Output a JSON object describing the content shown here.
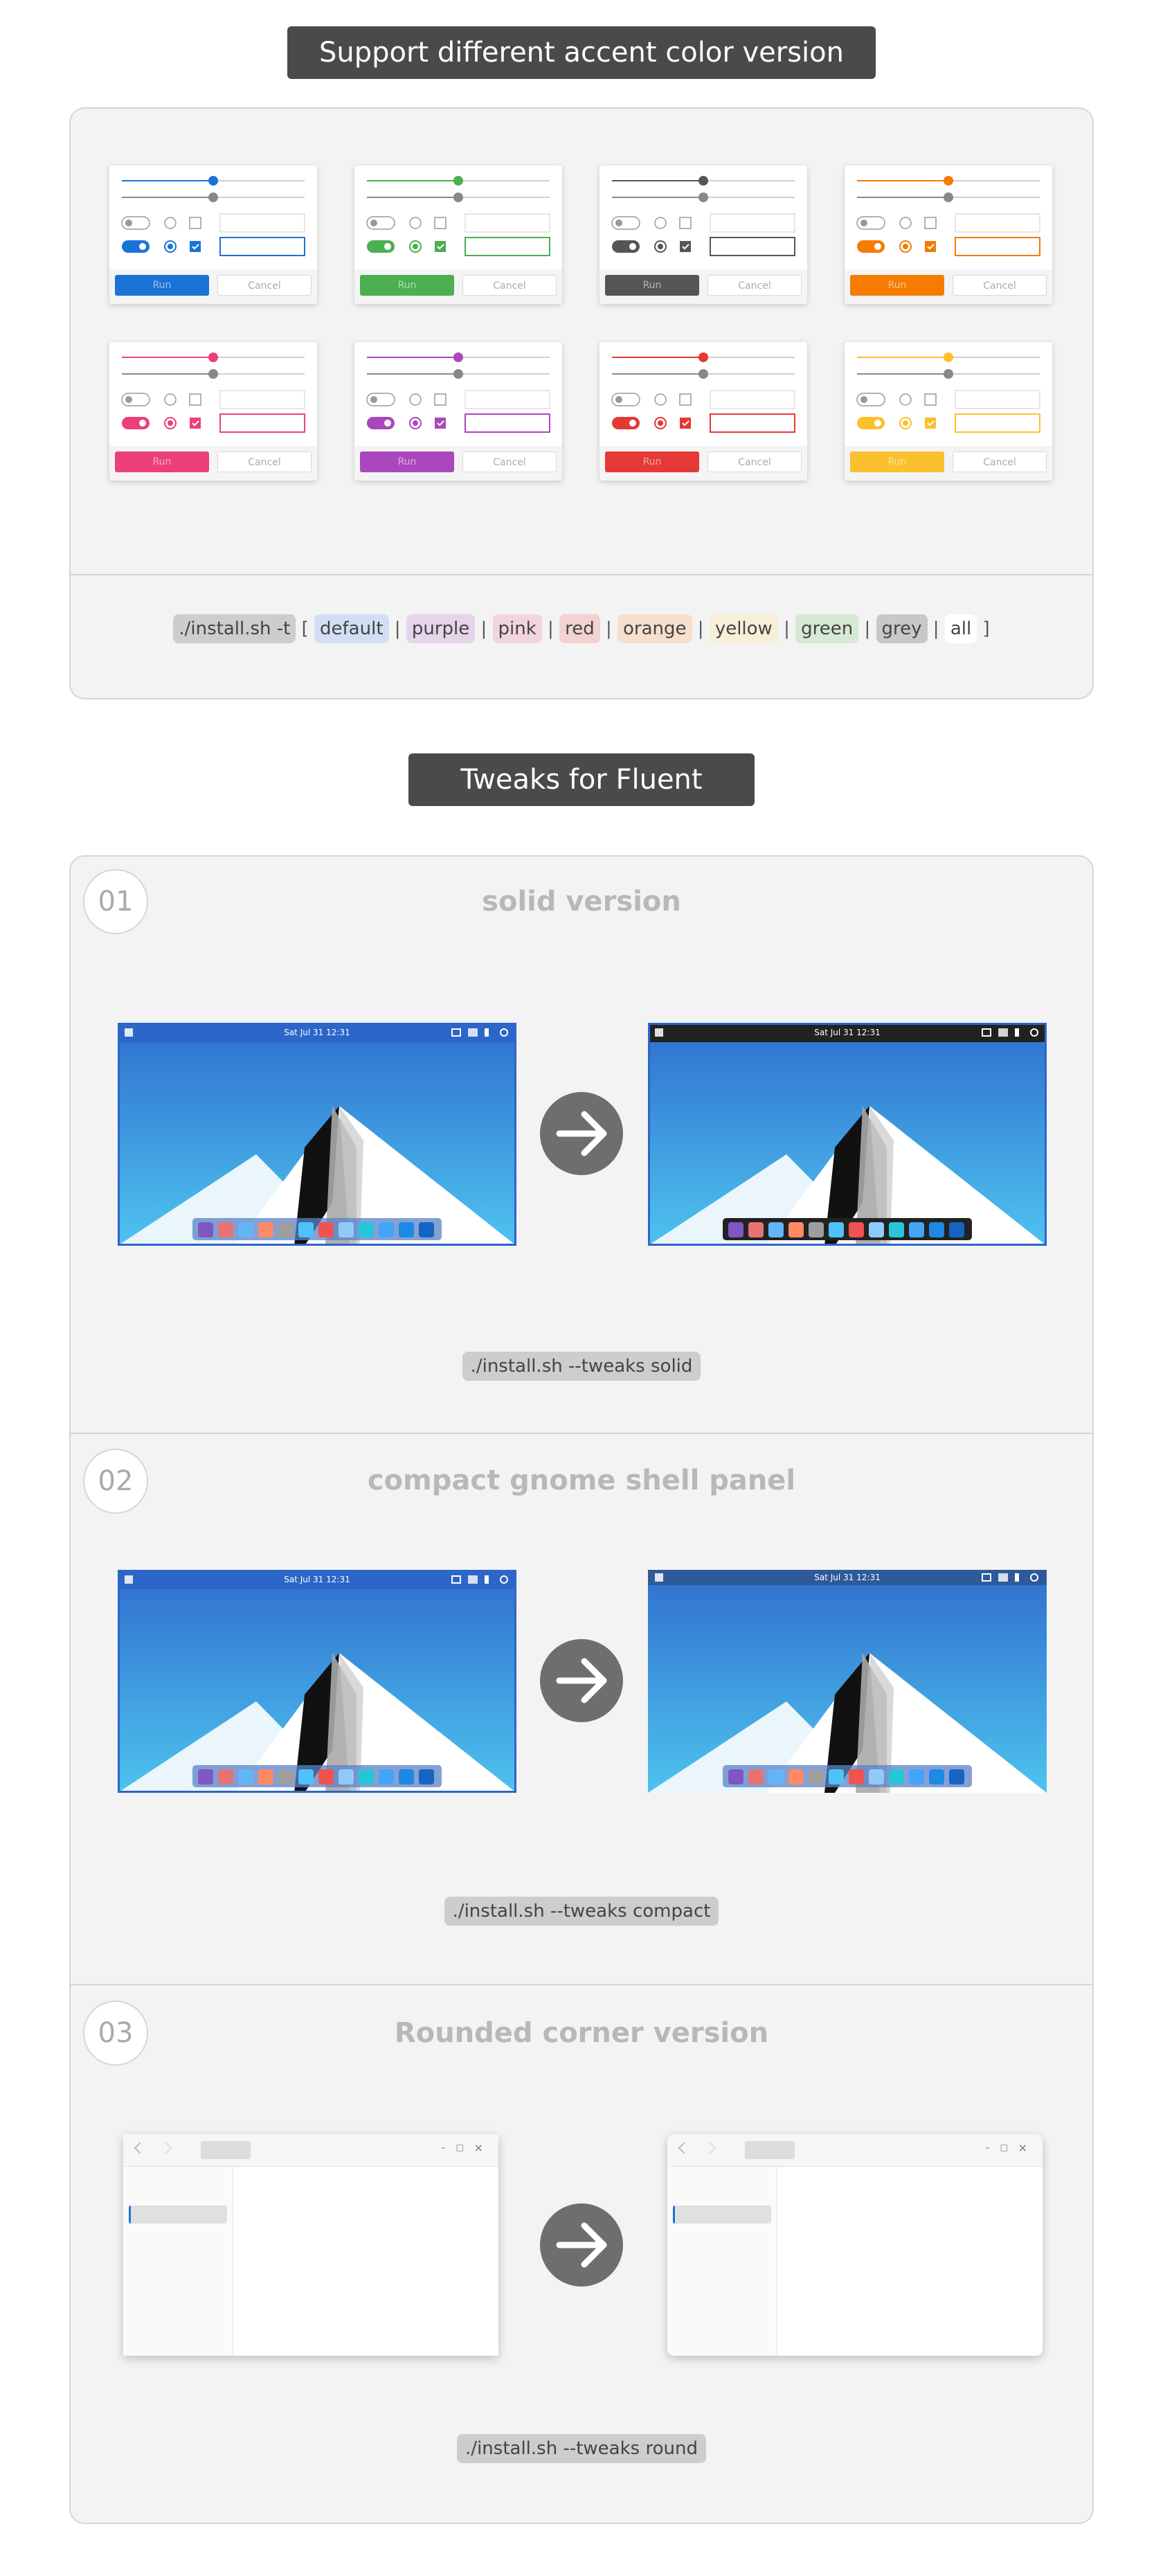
{
  "banner1": "Support different accent color version",
  "banner2": "Tweaks for Fluent",
  "accents": [
    {
      "name": "default",
      "color": "#1a73d6"
    },
    {
      "name": "green",
      "color": "#4caf50"
    },
    {
      "name": "grey",
      "color": "#555555"
    },
    {
      "name": "orange",
      "color": "#f57c00"
    },
    {
      "name": "pink",
      "color": "#ec407a"
    },
    {
      "name": "purple",
      "color": "#ab47bc"
    },
    {
      "name": "red",
      "color": "#e53935"
    },
    {
      "name": "yellow",
      "color": "#fbc02d"
    }
  ],
  "card": {
    "run_label": "Run",
    "cancel_label": "Cancel"
  },
  "install": {
    "prefix": "./install.sh -t",
    "open": "[",
    "close": "]",
    "sep": "|",
    "options": [
      {
        "label": "default",
        "bg": "#d2dff3"
      },
      {
        "label": "purple",
        "bg": "#e6d4ea"
      },
      {
        "label": "pink",
        "bg": "#f2d4dd"
      },
      {
        "label": "red",
        "bg": "#f3d2d2"
      },
      {
        "label": "orange",
        "bg": "#f6e0cc"
      },
      {
        "label": "yellow",
        "bg": "#f7efd8"
      },
      {
        "label": "green",
        "bg": "#d6e9d4"
      },
      {
        "label": "grey",
        "bg": "#c8c8c8"
      },
      {
        "label": "all",
        "bg": "#ffffff"
      }
    ]
  },
  "sections": [
    {
      "num": "01",
      "title": "solid version",
      "command": "./install.sh --tweaks solid"
    },
    {
      "num": "02",
      "title": "compact gnome shell panel",
      "command": "./install.sh --tweaks compact"
    },
    {
      "num": "03",
      "title": "Rounded corner version",
      "command": "./install.sh --tweaks round"
    }
  ],
  "desktop": {
    "clock": "Sat Jul 31  12:31"
  },
  "window": {
    "min": "–",
    "max": "□",
    "close": "×"
  }
}
